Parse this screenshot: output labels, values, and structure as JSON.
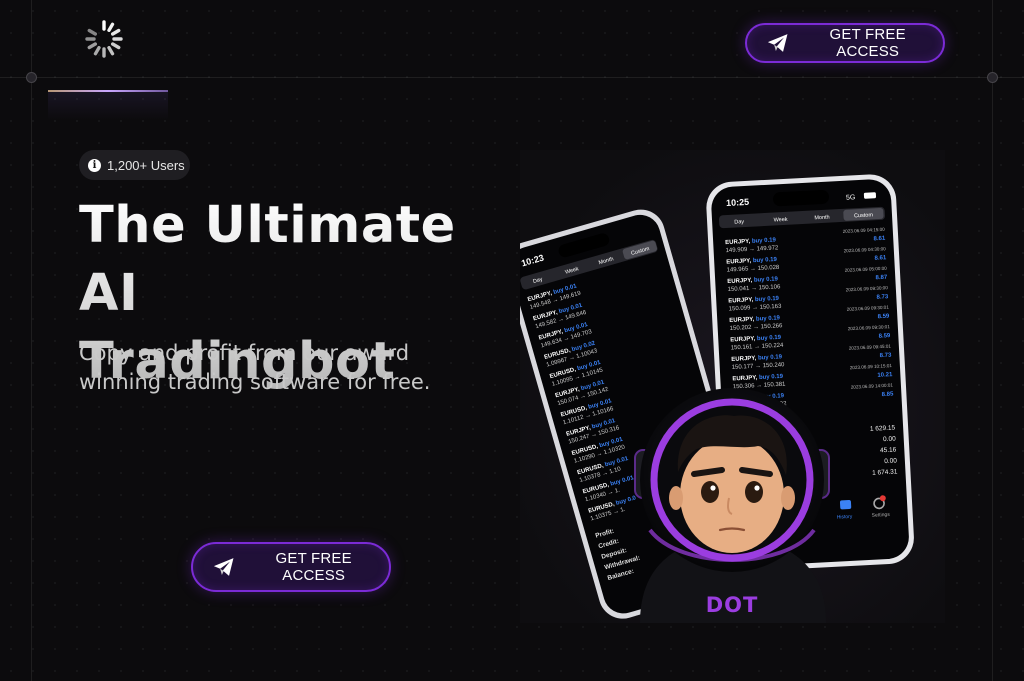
{
  "header": {
    "logo_icon": "loading-spinner-logo",
    "cta_label": "GET FREE ACCESS",
    "cta_icon": "paper-plane-icon"
  },
  "hero": {
    "badge": {
      "icon": "info-icon",
      "text": "1,200+ Users"
    },
    "title_line1": "The Ultimate AI",
    "title_line2": "Tradingbot",
    "subtitle": "Copy and profit from our award winning trading software for free.",
    "cta_label": "GET FREE ACCESS",
    "cta_icon": "paper-plane-icon"
  },
  "illustration": {
    "back_phone": {
      "time": "10:23",
      "tabs": [
        "Day",
        "Week",
        "Month",
        "Custom"
      ],
      "trades": [
        {
          "pair": "EURJPY,",
          "side": "buy 0.01",
          "range": "149.548 → 149.619"
        },
        {
          "pair": "EURJPY,",
          "side": "buy 0.01",
          "range": "149.582 → 149.646"
        },
        {
          "pair": "EURJPY,",
          "side": "buy 0.01",
          "range": "149.634 → 149.703"
        },
        {
          "pair": "EURUSD,",
          "side": "buy 0.02",
          "range": "1.09967 → 1.10043"
        },
        {
          "pair": "EURUSD,",
          "side": "buy 0.01",
          "range": "1.10095 → 1.10145"
        },
        {
          "pair": "EURJPY,",
          "side": "buy 0.01",
          "range": "150.074 → 150.142"
        },
        {
          "pair": "EURUSD,",
          "side": "buy 0.01",
          "range": "1.10112 → 1.10166"
        },
        {
          "pair": "EURJPY,",
          "side": "buy 0.01",
          "range": "150.247 → 150.316"
        },
        {
          "pair": "EURUSD,",
          "side": "buy 0.01",
          "range": "1.10290 → 1.10320"
        },
        {
          "pair": "EURUSD,",
          "side": "buy 0.01",
          "range": "1.10378 → 1.10"
        },
        {
          "pair": "EURUSD,",
          "side": "buy 0.01",
          "range": "1.10340 → 1."
        },
        {
          "pair": "EURUSD,",
          "side": "buy 0.0",
          "range": "1.10375 → 1."
        }
      ],
      "summary_labels": [
        "Profit:",
        "Credit:",
        "Deposit:",
        "Withdrawal:",
        "Balance:"
      ]
    },
    "front_phone": {
      "time": "10:25",
      "network": "5G",
      "tabs": [
        "Day",
        "Week",
        "Month",
        "Custom"
      ],
      "trades": [
        {
          "pair": "EURJPY,",
          "side": "buy 0.19",
          "range": "149.909 → 149.972",
          "date": "2023.06.09 04:15:00",
          "profit": "8.61"
        },
        {
          "pair": "EURJPY,",
          "side": "buy 0.19",
          "range": "149.965 → 150.028",
          "date": "2023.06.09 04:30:00",
          "profit": "8.61"
        },
        {
          "pair": "EURJPY,",
          "side": "buy 0.19",
          "range": "150.041 → 150.106",
          "date": "2023.06.09 05:00:00",
          "profit": "8.87"
        },
        {
          "pair": "EURJPY,",
          "side": "buy 0.19",
          "range": "150.099 → 150.163",
          "date": "2023.06.09 09:30:00",
          "profit": "8.73"
        },
        {
          "pair": "EURJPY,",
          "side": "buy 0.19",
          "range": "150.202 → 150.266",
          "date": "2023.06.09 09:30:01",
          "profit": "8.59"
        },
        {
          "pair": "EURJPY,",
          "side": "buy 0.19",
          "range": "150.161 → 150.224",
          "date": "2023.06.09 09:30:01",
          "profit": "8.59"
        },
        {
          "pair": "EURJPY,",
          "side": "buy 0.19",
          "range": "150.177 → 150.240",
          "date": "2023.06.09 09:45:01",
          "profit": "8.73"
        },
        {
          "pair": "EURJPY,",
          "side": "buy 0.19",
          "range": "150.306 → 150.381",
          "date": "2023.06.09 10:15:01",
          "profit": "10.21"
        },
        {
          "pair": "EURJPY,",
          "side": "buy 0.19",
          "range": "150.327 → 150.392",
          "date": "2023.06.09 14:00:01",
          "profit": "8.85"
        }
      ],
      "summary_values": [
        "1 629.15",
        "0.00",
        "45.16",
        "0.00",
        "1 674.31"
      ],
      "tab_bar": [
        "History",
        "Settings"
      ]
    },
    "mascot_label": "DOT"
  },
  "colors": {
    "accent": "#7b2bd6",
    "cta_bg": "#201038",
    "background": "#0c0b0d",
    "trade_blue": "#3b82f6"
  }
}
